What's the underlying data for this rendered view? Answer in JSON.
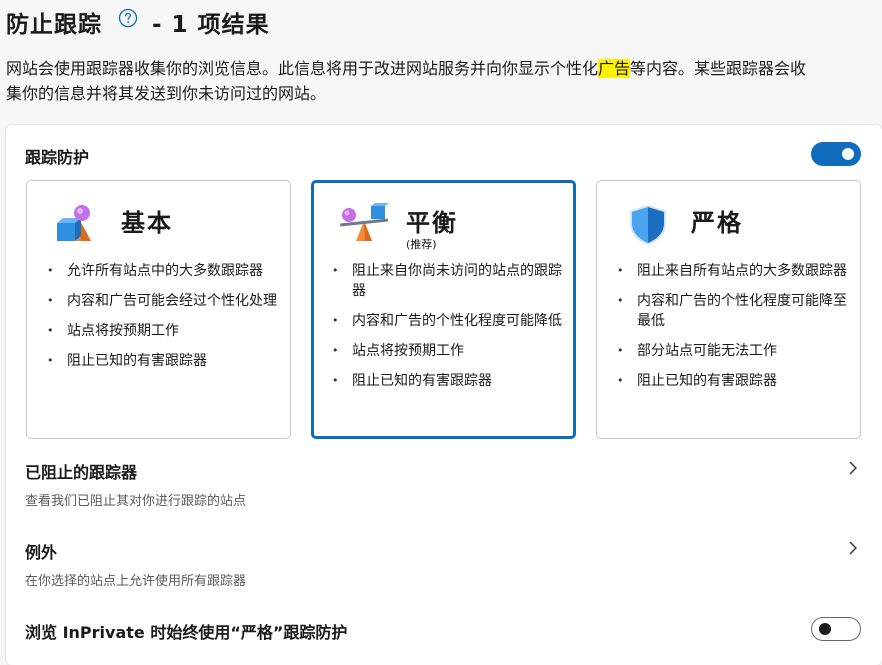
{
  "header": {
    "title": "防止跟踪",
    "results": "- 1 项结果"
  },
  "description": {
    "part1": "网站会使用跟踪器收集你的浏览信息。此信息将用于改进网站服务并向你显示个性化",
    "highlight": "广告",
    "part2": "等内容。某些跟踪器会收",
    "line2": "集你的信息并将其发送到你未访问过的网站。"
  },
  "tracking_prevention": {
    "label": "跟踪防护",
    "enabled": true
  },
  "cards": [
    {
      "title": "基本",
      "subtitle": "",
      "icon": "shapes-icon",
      "selected": false,
      "bullets": [
        "允许所有站点中的大多数跟踪器",
        "内容和广告可能会经过个性化处理",
        "站点将按预期工作",
        "阻止已知的有害跟踪器"
      ]
    },
    {
      "title": "平衡",
      "subtitle": "(推荐)",
      "icon": "scale-icon",
      "selected": true,
      "bullets": [
        "阻止来自你尚未访问的站点的跟踪器",
        "内容和广告的个性化程度可能降低",
        "站点将按预期工作",
        "阻止已知的有害跟踪器"
      ]
    },
    {
      "title": "严格",
      "subtitle": "",
      "icon": "shield-icon",
      "selected": false,
      "bullets": [
        "阻止来自所有站点的大多数跟踪器",
        "内容和广告的个性化程度可能降至最低",
        "部分站点可能无法工作",
        "阻止已知的有害跟踪器"
      ]
    }
  ],
  "blocked_trackers": {
    "title": "已阻止的跟踪器",
    "desc": "查看我们已阻止其对你进行跟踪的站点"
  },
  "exceptions": {
    "title": "例外",
    "desc": "在你选择的站点上允许使用所有跟踪器"
  },
  "inprivate": {
    "label": "浏览 InPrivate 时始终使用“严格”跟踪防护",
    "enabled": false
  },
  "colors": {
    "accent": "#0f6cbd",
    "highlight": "#fff200"
  }
}
